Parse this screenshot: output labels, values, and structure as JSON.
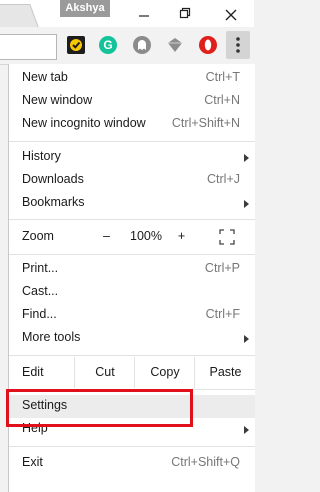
{
  "window": {
    "profile_name": "Akshya"
  },
  "extensions": [
    "norton-icon",
    "grammarly-icon",
    "ghostery-icon",
    "diamond-icon",
    "opera-icon"
  ],
  "extension_glyphs": {
    "grammarly": "G"
  },
  "menu": {
    "group1": [
      {
        "label": "New tab",
        "shortcut": "Ctrl+T"
      },
      {
        "label": "New window",
        "shortcut": "Ctrl+N"
      },
      {
        "label": "New incognito window",
        "shortcut": "Ctrl+Shift+N"
      }
    ],
    "group2": [
      {
        "label": "History",
        "submenu": true
      },
      {
        "label": "Downloads",
        "shortcut": "Ctrl+J"
      },
      {
        "label": "Bookmarks",
        "submenu": true
      }
    ],
    "zoom": {
      "label": "Zoom",
      "minus": "–",
      "level": "100%",
      "plus": "+"
    },
    "group3": [
      {
        "label": "Print...",
        "shortcut": "Ctrl+P"
      },
      {
        "label": "Cast..."
      },
      {
        "label": "Find...",
        "shortcut": "Ctrl+F"
      },
      {
        "label": "More tools",
        "submenu": true
      }
    ],
    "edit": {
      "label": "Edit",
      "cut": "Cut",
      "copy": "Copy",
      "paste": "Paste"
    },
    "group4": [
      {
        "label": "Settings"
      },
      {
        "label": "Help",
        "submenu": true
      }
    ],
    "exit": {
      "label": "Exit",
      "shortcut": "Ctrl+Shift+Q"
    }
  },
  "colors": {
    "highlight_box": "#e0101d",
    "hover_bg": "#ececec"
  }
}
